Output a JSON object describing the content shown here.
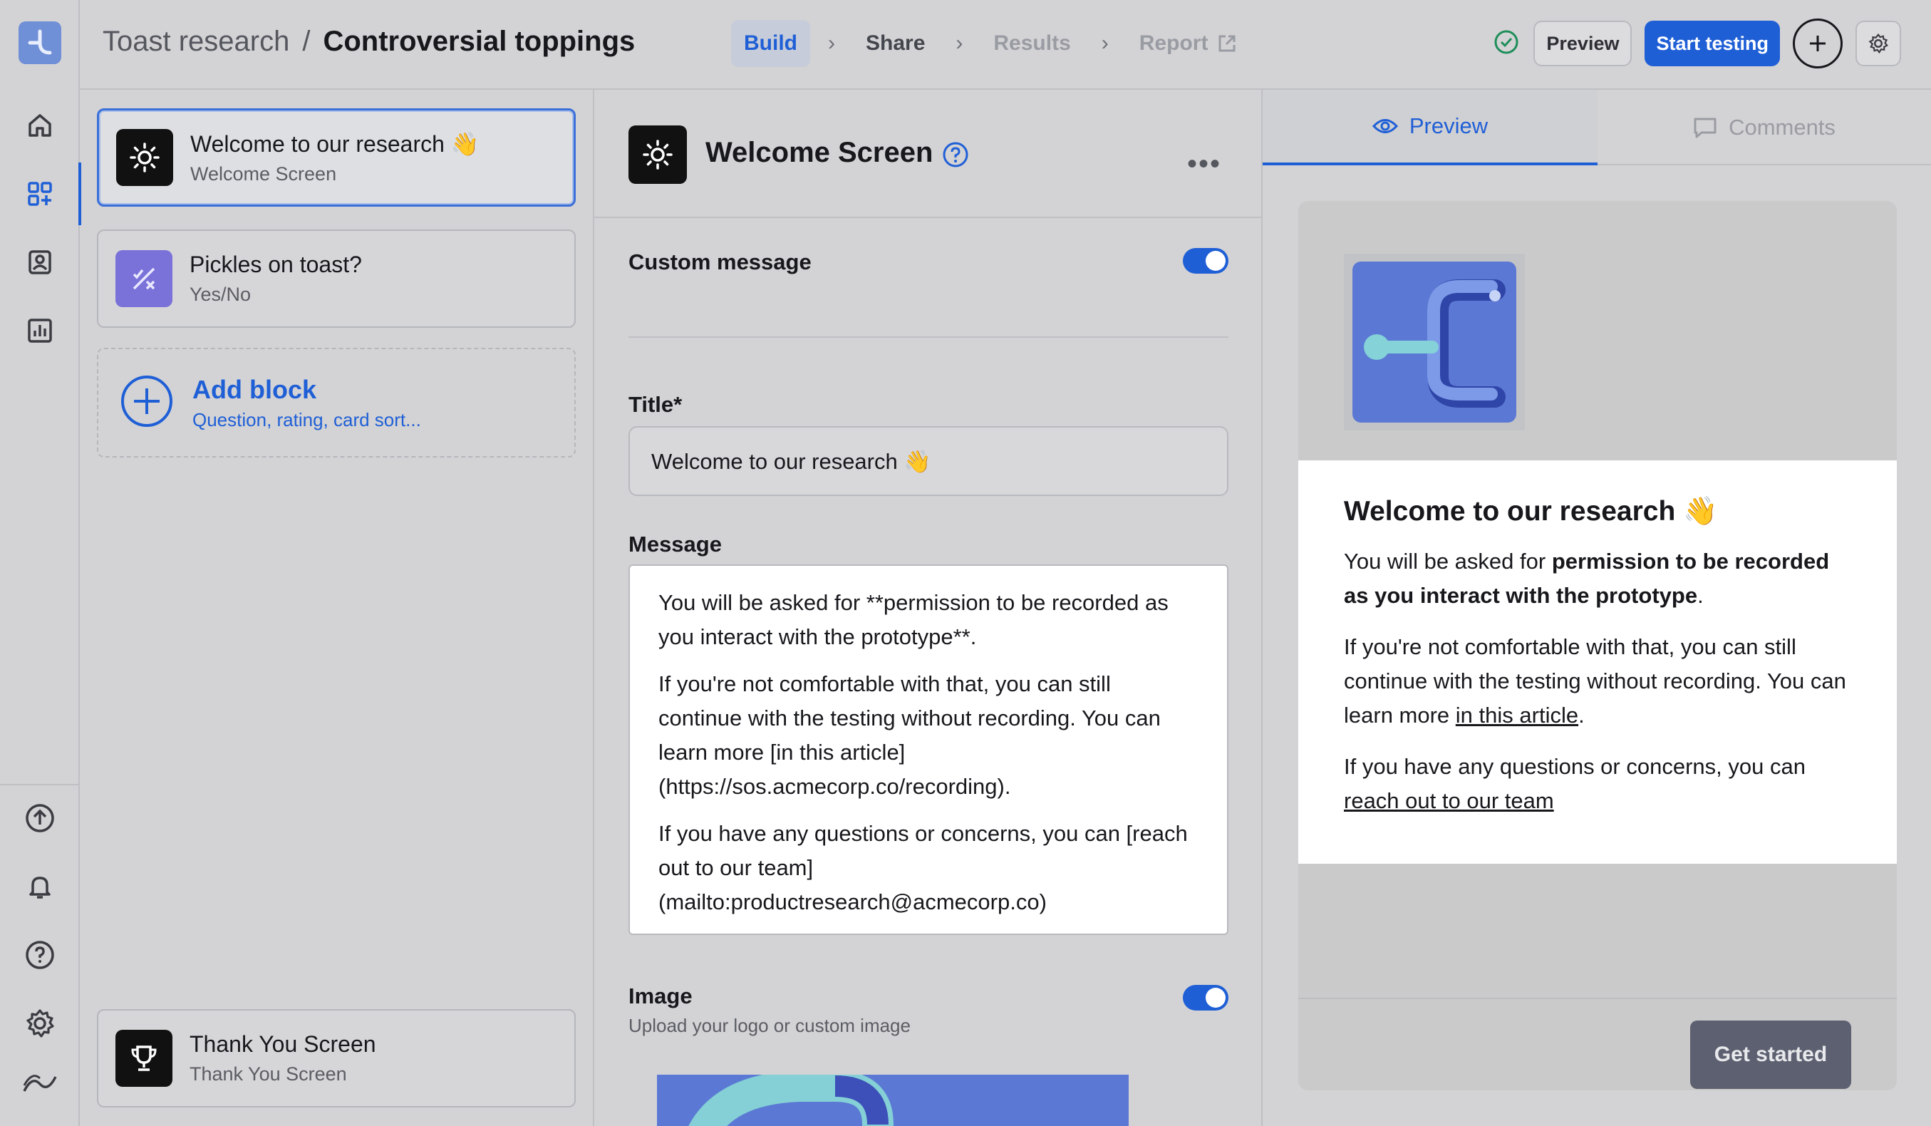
{
  "header": {
    "breadcrumb_parent": "Toast research",
    "breadcrumb_sep": "/",
    "breadcrumb_current": "Controversial toppings",
    "steps": [
      {
        "label": "Build",
        "state": "active"
      },
      {
        "label": "Share",
        "state": "normal"
      },
      {
        "label": "Results",
        "state": "disabled"
      },
      {
        "label": "Report",
        "state": "disabled"
      }
    ],
    "preview_label": "Preview",
    "start_label": "Start testing"
  },
  "rail": {
    "top_icons": [
      "home-icon",
      "blocks-icon",
      "contacts-icon",
      "bar-chart-icon"
    ],
    "bottom_icons": [
      "upload-icon",
      "bell-icon",
      "help-icon",
      "gear-icon",
      "brand-mark-icon"
    ]
  },
  "blocks": {
    "items": [
      {
        "title": "Welcome to our research 👋",
        "subtitle": "Welcome Screen"
      },
      {
        "title": "Pickles on toast?",
        "subtitle": "Yes/No"
      }
    ],
    "add_title": "Add block",
    "add_subtitle": "Question, rating, card sort...",
    "end": {
      "title": "Thank You Screen",
      "subtitle": "Thank You Screen"
    }
  },
  "editor": {
    "heading": "Welcome Screen",
    "custom_message_label": "Custom message",
    "custom_message_on": true,
    "title_label": "Title*",
    "title_value": "Welcome to our research 👋",
    "message_label": "Message",
    "message_paragraphs": [
      "You will be asked for **permission to be recorded as you interact with the prototype**.",
      "If you're not comfortable with that, you can still continue with the testing without recording. You can learn more [in this article](https://sos.acmecorp.co/recording).",
      "If you have any questions or concerns, you can [reach out to our team](mailto:productresearch@acmecorp.co)"
    ],
    "image_label": "Image",
    "image_hint": "Upload your logo or custom image",
    "image_on": true
  },
  "preview": {
    "tab_preview": "Preview",
    "tab_comments": "Comments",
    "title": "Welcome to our research 👋",
    "p1_before": "You will be asked for ",
    "p1_bold": "permission to be recorded as you interact with the prototype",
    "p1_after": ".",
    "p2_before": "If you're not comfortable with that, you can still continue with the testing without recording. You can learn more ",
    "p2_link": "in this article",
    "p2_after": ".",
    "p3_before": "If you have any questions or concerns, you can ",
    "p3_link": "reach out to our team",
    "cta": "Get started"
  },
  "colors": {
    "accent": "#1f5fd6",
    "background": "#d3d3d5",
    "cta": "#5d6070"
  }
}
